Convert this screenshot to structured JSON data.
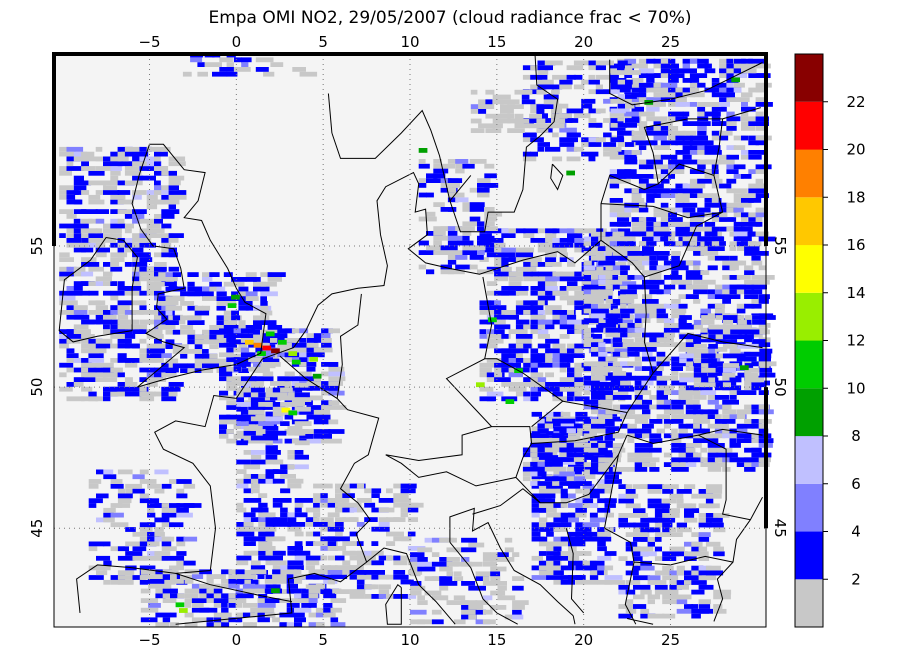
{
  "map": {
    "title": "Empa OMI NO2, 29/05/2007 (cloud radiance frac < 70%)",
    "lon_range": [
      -10.5,
      30.5
    ],
    "lat_range": [
      41.5,
      61.8
    ],
    "lon_ticks": [
      -5,
      0,
      5,
      10,
      15,
      20,
      25
    ],
    "lat_ticks": [
      45,
      50,
      55
    ],
    "lon_tick_labels": [
      "−5",
      "0",
      "5",
      "10",
      "15",
      "20",
      "25"
    ],
    "lat_tick_labels": [
      "45",
      "50",
      "55"
    ],
    "land_color": "#f4f4f4",
    "grid": true,
    "colorbar": {
      "bins": [
        {
          "color": "#c8c8c8"
        },
        {
          "color": "#0000ff"
        },
        {
          "color": "#8080ff"
        },
        {
          "color": "#c0c0ff"
        },
        {
          "color": "#00a000"
        },
        {
          "color": "#00cc00"
        },
        {
          "color": "#99ee00"
        },
        {
          "color": "#ffff00"
        },
        {
          "color": "#ffc800"
        },
        {
          "color": "#ff8000"
        },
        {
          "color": "#ff0000"
        },
        {
          "color": "#880000"
        }
      ],
      "labels": [
        "2",
        "4",
        "6",
        "8",
        "10",
        "12",
        "14",
        "16",
        "18",
        "20",
        "22"
      ]
    }
  }
}
